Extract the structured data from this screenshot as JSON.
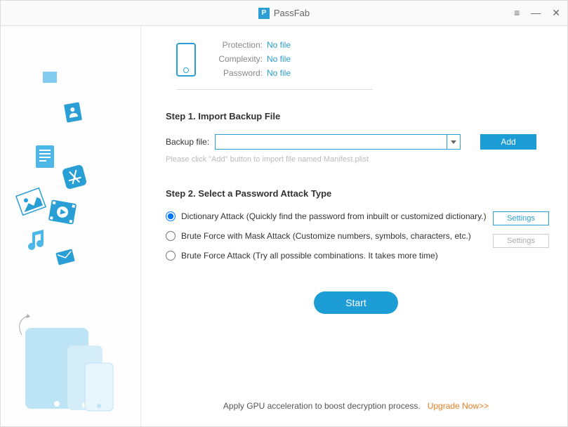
{
  "app": {
    "name": "PassFab"
  },
  "window_controls": {
    "menu": "≡",
    "minimize": "—",
    "close": "✕"
  },
  "info": {
    "protection_label": "Protection:",
    "protection_value": "No file",
    "complexity_label": "Complexity:",
    "complexity_value": "No file",
    "password_label": "Password:",
    "password_value": "No file"
  },
  "step1": {
    "title": "Step 1. Import Backup File",
    "label": "Backup file:",
    "add_button": "Add",
    "hint": "Please click \"Add\" button to import file named Manifest.plist"
  },
  "step2": {
    "title": "Step 2. Select a Password Attack Type",
    "options": [
      {
        "label": "Dictionary Attack (Quickly find the password from inbuilt or customized dictionary.)",
        "selected": true
      },
      {
        "label": "Brute Force with Mask Attack (Customize numbers, symbols, characters, etc.)",
        "selected": false
      },
      {
        "label": "Brute Force Attack (Try all possible combinations. It takes more time)",
        "selected": false
      }
    ],
    "settings_button": "Settings"
  },
  "start_button": "Start",
  "footer": {
    "text": "Apply GPU acceleration to boost decryption process.",
    "upgrade": "Upgrade Now>>"
  }
}
